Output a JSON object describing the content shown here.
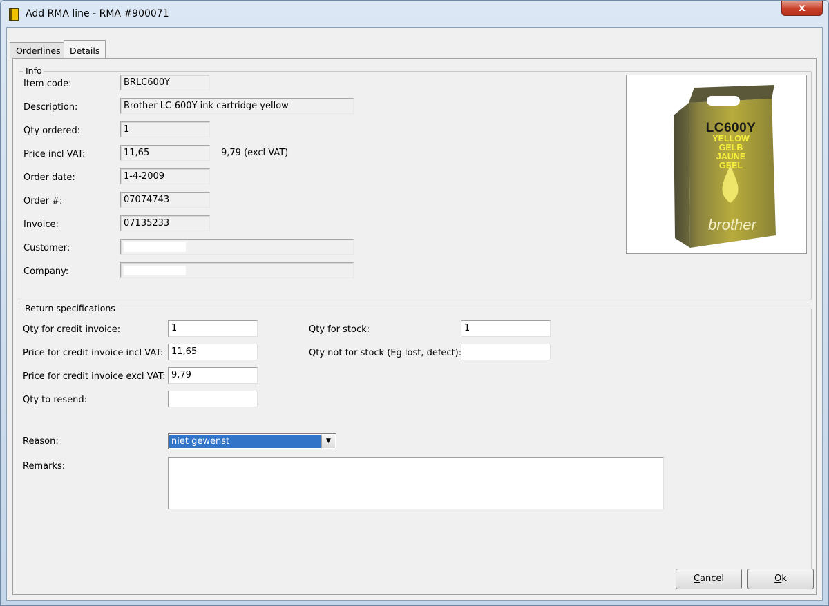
{
  "window": {
    "title": "Add RMA line - RMA #900071",
    "close_symbol": "x"
  },
  "tabs": [
    {
      "label": "Orderlines",
      "active": false
    },
    {
      "label": "Details",
      "active": true
    }
  ],
  "info": {
    "legend": "Info",
    "fields": [
      {
        "label": "Item code:",
        "value": "BRLC600Y"
      },
      {
        "label": "Description:",
        "value": "Brother LC-600Y ink cartridge yellow"
      },
      {
        "label": "Qty ordered:",
        "value": "1"
      },
      {
        "label": "Price incl VAT:",
        "value": "11,65"
      },
      {
        "label": "Order date:",
        "value": "1-4-2009"
      },
      {
        "label": "Order #:",
        "value": "07074743"
      },
      {
        "label": "Invoice:",
        "value": "07135233"
      },
      {
        "label": "Customer:",
        "value": ""
      },
      {
        "label": "Company:",
        "value": ""
      }
    ],
    "price_excl": "9,79  (excl VAT)"
  },
  "product_image": {
    "model": "LC600Y",
    "colors": [
      "YELLOW",
      "GELB",
      "JAUNE",
      "GEEL"
    ],
    "brand": "brother",
    "box_color": "#e4d84a",
    "box_dark": "#3a3a34"
  },
  "returns": {
    "legend": "Return specifications",
    "qty_credit": {
      "label": "Qty for credit invoice:",
      "value": "1"
    },
    "price_credit_incl": {
      "label": "Price for credit invoice incl VAT:",
      "value": "11,65"
    },
    "price_credit_excl": {
      "label": "Price for credit invoice excl VAT:",
      "value": "9,79"
    },
    "qty_resend": {
      "label": "Qty to resend:",
      "value": ""
    },
    "qty_stock": {
      "label": "Qty for stock:",
      "value": "1"
    },
    "qty_not_stock": {
      "label": "Qty not for stock (Eg lost, defect):",
      "value": ""
    },
    "reason": {
      "label": "Reason:",
      "value": "niet gewenst"
    },
    "remarks": {
      "label": "Remarks:",
      "value": ""
    }
  },
  "buttons": {
    "cancel_first": "C",
    "cancel_rest": "ancel",
    "ok_first": "O",
    "ok_rest": "k"
  }
}
